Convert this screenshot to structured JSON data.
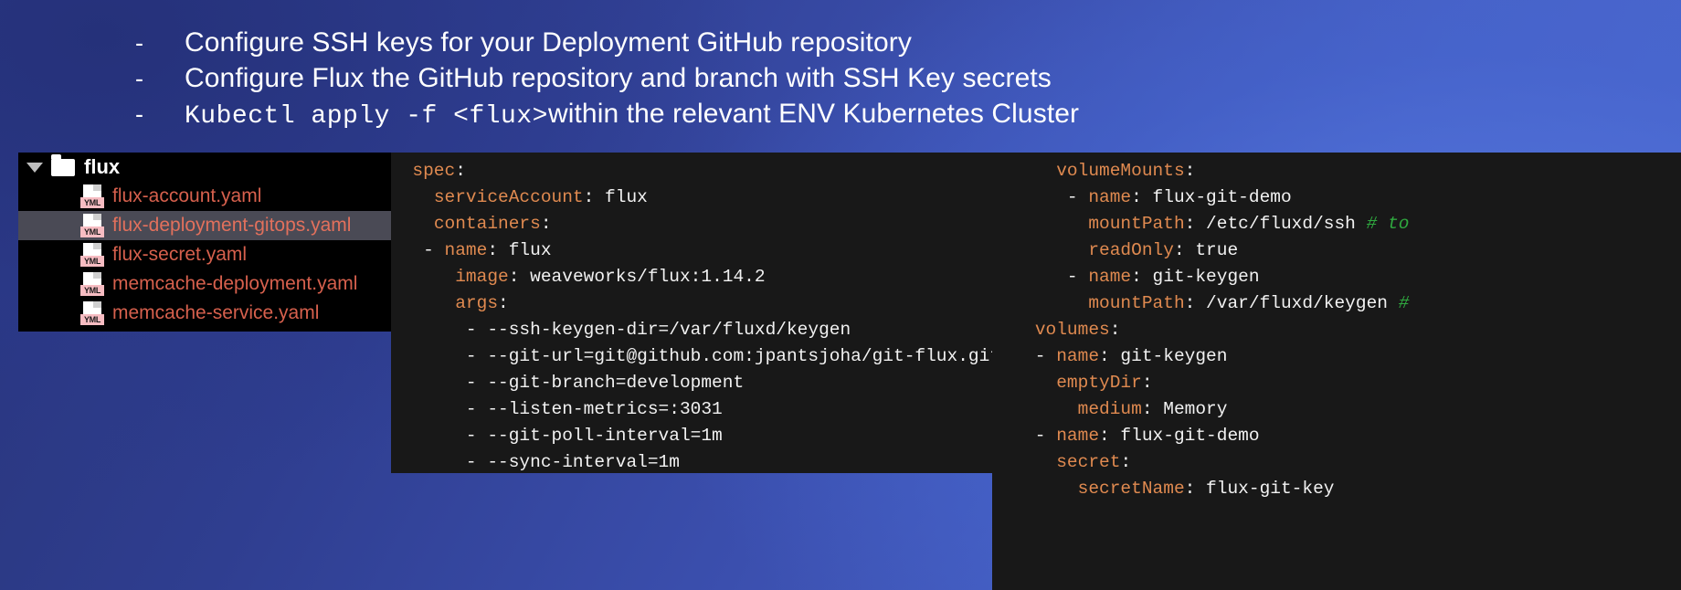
{
  "slide": {
    "background_gradient_from": "#283478",
    "background_gradient_to": "#4f6ad2",
    "bullets": [
      {
        "dash": "-",
        "segments": [
          {
            "text": "Configure SSH keys for your Deployment GitHub repository",
            "style": "sans"
          }
        ]
      },
      {
        "dash": "-",
        "segments": [
          {
            "text": "Configure Flux the GitHub repository and branch with SSH Key secrets",
            "style": "sans"
          }
        ]
      },
      {
        "dash": "-",
        "segments": [
          {
            "text": "Kubectl apply -f <flux>",
            "style": "mono"
          },
          {
            "text": " within the relevant ENV Kubernetes Cluster",
            "style": "sans"
          }
        ]
      }
    ]
  },
  "bullet_lines": {
    "line1_dash": "-",
    "line1_text": "Configure SSH keys for your Deployment GitHub repository",
    "line2_dash": "-",
    "line2_text": "Configure Flux the GitHub repository and branch with SSH Key secrets",
    "line3_dash": "-",
    "line3_mono": "Kubectl apply -f <flux>",
    "line3_text": " within the relevant ENV Kubernetes Cluster"
  },
  "file_tree": {
    "background": "#000000",
    "folder": {
      "name": "flux",
      "expanded": true,
      "caret": "chevron-down-icon"
    },
    "selected_index": 1,
    "files": [
      {
        "name": "flux-account.yaml",
        "type": "YML",
        "selected": false
      },
      {
        "name": "flux-deployment-gitops.yaml",
        "type": "YML",
        "selected": true
      },
      {
        "name": "flux-secret.yaml",
        "type": "YML",
        "selected": false
      },
      {
        "name": "memcache-deployment.yaml",
        "type": "YML",
        "selected": false
      },
      {
        "name": "memcache-service.yaml",
        "type": "YML",
        "selected": false
      }
    ],
    "file_text_color": "#d6604d",
    "badge_color": "#f7bcc2",
    "selected_row_color": "#4a4a55"
  },
  "code_middle": {
    "background": "#181818",
    "key_color": "#e08a50",
    "value_color": "#f2f2f2",
    "lines": [
      [
        {
          "t": "  ",
          "c": "ind"
        },
        {
          "t": "spec",
          "c": "k"
        },
        {
          "t": ":",
          "c": "p"
        }
      ],
      [
        {
          "t": "    ",
          "c": "ind"
        },
        {
          "t": "serviceAccount",
          "c": "k"
        },
        {
          "t": ": flux",
          "c": "v"
        }
      ],
      [
        {
          "t": "    ",
          "c": "ind"
        },
        {
          "t": "containers",
          "c": "k"
        },
        {
          "t": ":",
          "c": "p"
        }
      ],
      [
        {
          "t": "   - ",
          "c": "d"
        },
        {
          "t": "name",
          "c": "k"
        },
        {
          "t": ": flux",
          "c": "v"
        }
      ],
      [
        {
          "t": "      ",
          "c": "ind"
        },
        {
          "t": "image",
          "c": "k"
        },
        {
          "t": ": weaveworks/flux:1.14.2",
          "c": "v"
        }
      ],
      [
        {
          "t": "      ",
          "c": "ind"
        },
        {
          "t": "args",
          "c": "k"
        },
        {
          "t": ":",
          "c": "p"
        }
      ],
      [
        {
          "t": "       - --ssh-keygen-dir=/var/fluxd/keygen",
          "c": "v"
        }
      ],
      [
        {
          "t": "       - --git-url=git@github.com:jpantsjoha/git-flux.git",
          "c": "v"
        }
      ],
      [
        {
          "t": "       - --git-branch=development",
          "c": "v"
        }
      ],
      [
        {
          "t": "       - --listen-metrics=:3031",
          "c": "v"
        }
      ],
      [
        {
          "t": "       - --git-poll-interval=1m",
          "c": "v"
        }
      ],
      [
        {
          "t": "       - --sync-interval=1m",
          "c": "v"
        }
      ]
    ],
    "plain_text": "spec:\n  serviceAccount: flux\n  containers:\n  - name: flux\n    image: weaveworks/flux:1.14.2\n    args:\n     - --ssh-keygen-dir=/var/fluxd/keygen\n     - --git-url=git@github.com:jpantsjoha/git-flux.git\n     - --git-branch=development\n     - --listen-metrics=:3031\n     - --git-poll-interval=1m\n     - --sync-interval=1m"
  },
  "code_right": {
    "background": "#181818",
    "key_color": "#e08a50",
    "value_color": "#f2f2f2",
    "comment_color": "#2fa83f",
    "lines": [
      [
        {
          "t": "      ",
          "c": "ind"
        },
        {
          "t": "volumeMounts",
          "c": "k"
        },
        {
          "t": ":",
          "c": "p"
        }
      ],
      [
        {
          "t": "       - ",
          "c": "d"
        },
        {
          "t": "name",
          "c": "k"
        },
        {
          "t": ": flux-git-demo",
          "c": "v"
        }
      ],
      [
        {
          "t": "         ",
          "c": "ind"
        },
        {
          "t": "mountPath",
          "c": "k"
        },
        {
          "t": ": /etc/fluxd/ssh ",
          "c": "v"
        },
        {
          "t": "# to",
          "c": "c"
        }
      ],
      [
        {
          "t": "         ",
          "c": "ind"
        },
        {
          "t": "readOnly",
          "c": "k"
        },
        {
          "t": ": true",
          "c": "v"
        }
      ],
      [
        {
          "t": "       - ",
          "c": "d"
        },
        {
          "t": "name",
          "c": "k"
        },
        {
          "t": ": git-keygen",
          "c": "v"
        }
      ],
      [
        {
          "t": "         ",
          "c": "ind"
        },
        {
          "t": "mountPath",
          "c": "k"
        },
        {
          "t": ": /var/fluxd/keygen ",
          "c": "v"
        },
        {
          "t": "#",
          "c": "c"
        }
      ],
      [
        {
          "t": "    ",
          "c": "ind"
        },
        {
          "t": "volumes",
          "c": "k"
        },
        {
          "t": ":",
          "c": "p"
        }
      ],
      [
        {
          "t": "    - ",
          "c": "d"
        },
        {
          "t": "name",
          "c": "k"
        },
        {
          "t": ": git-keygen",
          "c": "v"
        }
      ],
      [
        {
          "t": "      ",
          "c": "ind"
        },
        {
          "t": "emptyDir",
          "c": "k"
        },
        {
          "t": ":",
          "c": "p"
        }
      ],
      [
        {
          "t": "        ",
          "c": "ind"
        },
        {
          "t": "medium",
          "c": "k"
        },
        {
          "t": ": Memory",
          "c": "v"
        }
      ],
      [
        {
          "t": "    - ",
          "c": "d"
        },
        {
          "t": "name",
          "c": "k"
        },
        {
          "t": ": flux-git-demo",
          "c": "v"
        }
      ],
      [
        {
          "t": "      ",
          "c": "ind"
        },
        {
          "t": "secret",
          "c": "k"
        },
        {
          "t": ":",
          "c": "p"
        }
      ],
      [
        {
          "t": "        ",
          "c": "ind"
        },
        {
          "t": "secretName",
          "c": "k"
        },
        {
          "t": ": flux-git-key",
          "c": "v"
        }
      ]
    ],
    "plain_text": "volumeMounts:\n - name: flux-git-demo\n   mountPath: /etc/fluxd/ssh # to\n   readOnly: true\n - name: git-keygen\n   mountPath: /var/fluxd/keygen #\nvolumes:\n- name: git-keygen\n  emptyDir:\n    medium: Memory\n- name: flux-git-demo\n  secret:\n    secretName: flux-git-key"
  }
}
